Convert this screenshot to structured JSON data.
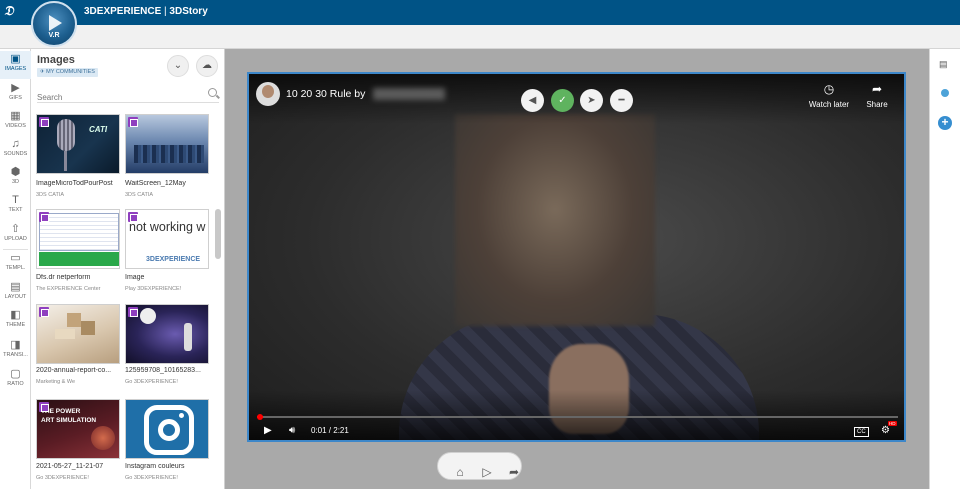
{
  "header": {
    "brand": "3DEXPERIENCE",
    "separator": " | ",
    "app": "3DStory",
    "compass_version": "V.R"
  },
  "rail": {
    "items": [
      {
        "label": "IMAGES",
        "icon": "image-icon",
        "glyph": "▣"
      },
      {
        "label": "GIFS",
        "icon": "gif-icon",
        "glyph": "▶"
      },
      {
        "label": "VIDEOS",
        "icon": "video-icon",
        "glyph": "▦"
      },
      {
        "label": "SOUNDS",
        "icon": "music-icon",
        "glyph": "♫"
      },
      {
        "label": "3D",
        "icon": "cube-icon",
        "glyph": "⬡"
      },
      {
        "label": "TEXT",
        "icon": "text-icon",
        "glyph": "T"
      },
      {
        "label": "UPLOAD",
        "icon": "upload-icon",
        "glyph": "⇧"
      },
      {
        "label": "TEMPL.",
        "icon": "template-icon",
        "glyph": "▭"
      },
      {
        "label": "LAYOUT",
        "icon": "layout-icon",
        "glyph": "▤"
      },
      {
        "label": "THEME",
        "icon": "theme-icon",
        "glyph": "◧"
      },
      {
        "label": "TRANSI...",
        "icon": "transition-icon",
        "glyph": "◨"
      },
      {
        "label": "RATIO",
        "icon": "ratio-icon",
        "glyph": "▢"
      }
    ]
  },
  "panel": {
    "title": "Images",
    "community": "MY COMMUNITIES",
    "search_placeholder": "Search",
    "items": [
      {
        "title": "ImageMicroTodPourPost",
        "source": "3DS CATIA"
      },
      {
        "title": "WaitScreen_12May",
        "source": "3DS CATIA"
      },
      {
        "title": "Dfs.dr netperform",
        "source": "The EXPERIENCE Center"
      },
      {
        "title": "Image",
        "source": "Play 3DEXPERIENCE!"
      },
      {
        "title": "2020-annual-report-co...",
        "source": "Marketing & We"
      },
      {
        "title": "125959708_10165283...",
        "source": "Go 3DEXPERIENCE!"
      },
      {
        "title": "2021-05-27_11-21-07",
        "source": "Go 3DEXPERIENCE!"
      },
      {
        "title": "Instagram couleurs",
        "source": "Go 3DEXPERIENCE!"
      }
    ],
    "thumb_texts": {
      "catia": "CATI",
      "not_working": "not working w",
      "exp_small": "3DEXPERIENCE",
      "power1": "THE POWER",
      "power2": "ART SIMULATION"
    }
  },
  "video": {
    "title": "10 20 30 Rule by",
    "watch_later": "Watch later",
    "share": "Share",
    "time": "0:01 / 2:21",
    "progress": 0.007,
    "cc": "CC",
    "hd": "HD"
  },
  "colors": {
    "header": "#005386",
    "accent": "#3d87c9",
    "check": "#5fb35f",
    "badge": "#8f3fbf"
  }
}
